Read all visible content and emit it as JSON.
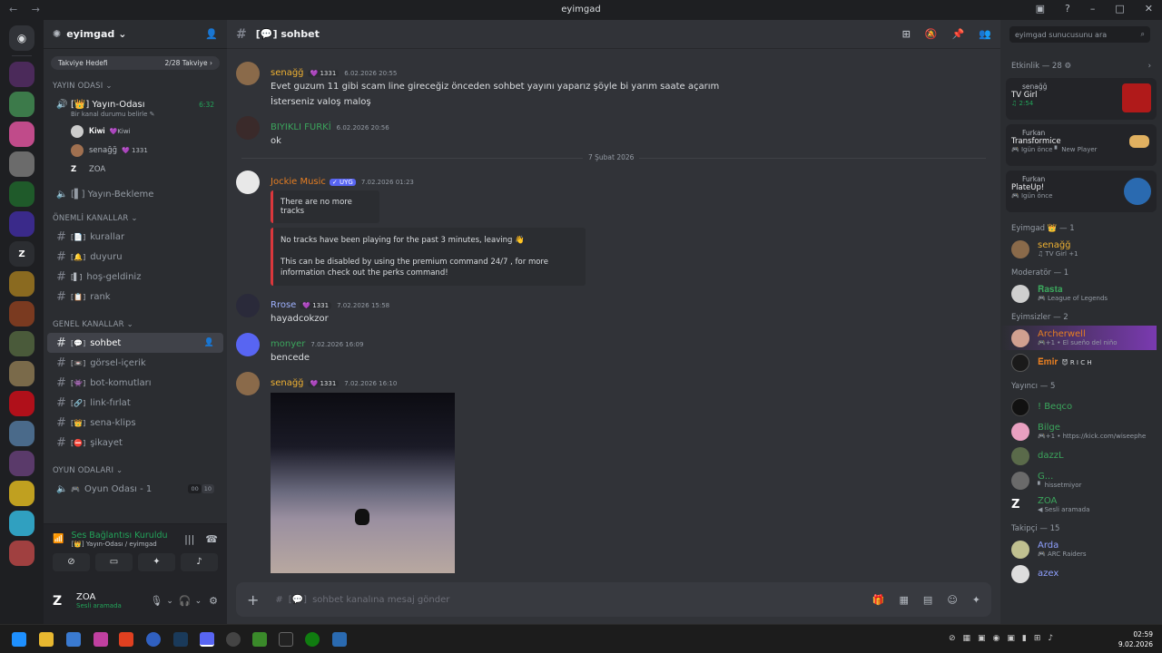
{
  "window": {
    "title": "eyimgad"
  },
  "server": {
    "name": "eyimgad",
    "boost_label": "Takviye Hedefi",
    "boost_count": "2/28 Takviye ›"
  },
  "channels": {
    "cat_voice": "YAYIN ODASI ⌄",
    "voice_room": "[👑] Yayın-Odası",
    "voice_time": "6:32",
    "voice_status": "Bir kanal durumu belirle ✎",
    "voice_users": [
      {
        "name": "𝐊𝐢𝐰𝐢",
        "tag": "💜Kiwi"
      },
      {
        "name": "senağğ",
        "tag": "💜 1331"
      },
      {
        "name": "ZOA",
        "tag": ""
      }
    ],
    "wait_room": "[▌] Yayın-Bekleme",
    "cat_important": "ÖNEMLİ KANALLAR ⌄",
    "important": [
      "kurallar",
      "duyuru",
      "hoş-geldiniz",
      "rank"
    ],
    "cat_general": "GENEL KANALLAR ⌄",
    "general": [
      "sohbet",
      "görsel-içerik",
      "bot-komutları",
      "link-fırlat",
      "sena-klips",
      "şikayet"
    ],
    "cat_game": "OYUN ODALARI ⌄",
    "game_room": "Oyun Odası - 1",
    "game_count_a": "00",
    "game_count_b": "10"
  },
  "voicebar": {
    "status": "Ses Bağlantısı Kuruldu",
    "channel": "[👑] Yayın-Odası / eyimgad"
  },
  "userbar": {
    "name": "ZOA",
    "status": "Sesli aramada"
  },
  "chat": {
    "channel": "[💬] sohbet",
    "messages": [
      {
        "author": "senağğ",
        "tag": "💜 1331",
        "time": "6.02.2026 20:55",
        "lines": [
          "Evet guzum 11 gibi scam line gireceğiz önceden sohbet yayını yaparız şöyle bi yarım saate açarım",
          "İsterseniz valoş maloş"
        ]
      },
      {
        "author": "BIYIKLI FURKİ",
        "time": "6.02.2026 20:56",
        "lines": [
          "ok"
        ]
      },
      {
        "author": "Jockie Music",
        "tag": "✓ UYG",
        "time": "7.02.2026 01:23",
        "embed1": "There are no more tracks",
        "embed2a": "No tracks have been playing for the past 3 minutes, leaving 👋",
        "embed2b": "This can be disabled by using the premium command 24/7 , for more information check out the perks command!"
      },
      {
        "author": "Rrose",
        "tag": "💜 1331",
        "time": "7.02.2026 15:58",
        "lines": [
          "hayadcokzor"
        ]
      },
      {
        "author": "monyer",
        "time": "7.02.2026 16:09",
        "lines": [
          "bencede"
        ]
      },
      {
        "author": "senağğ",
        "tag": "💜 1331",
        "time": "7.02.2026 16:10"
      }
    ],
    "divider": "7 Şubat 2026",
    "composer_placeholder": "sohbet kanalına mesaj gönder"
  },
  "members": {
    "search_placeholder": "eyimgad sunucusunu ara",
    "activity_title": "Etkinlik — 28 ⚙",
    "activities": [
      {
        "user": "senağğ",
        "title": "TV Girl",
        "sub": "♫ 2:54"
      },
      {
        "user": "Furkan",
        "title": "Transformice",
        "sub": "🎮 Igün önce  ▘ New Player"
      },
      {
        "user": "Furkan",
        "title": "PlateUp!",
        "sub": "🎮 Igün önce"
      }
    ],
    "groups": [
      {
        "title": "Eyimgad 👑 — 1",
        "items": [
          {
            "name": "senağğ",
            "sub": "♫ TV Girl +1",
            "color": "#f0b232"
          }
        ]
      },
      {
        "title": "Moderatör — 1",
        "items": [
          {
            "name": "𝐑𝐚𝐬𝐭𝐚",
            "sub": "🎮 League of Legends",
            "color": "#3ba55c"
          }
        ]
      },
      {
        "title": "Eyimsizler — 2",
        "items": [
          {
            "name": "Archerwell",
            "sub": "🎮+1 • El sueño del niño",
            "color": "#e67e22"
          },
          {
            "name": "𝐄𝐦𝐢𝐫",
            "sub": "😈 R I C H",
            "color": "#e67e22"
          }
        ]
      },
      {
        "title": "Yayıncı — 5",
        "items": [
          {
            "name": "! Beqco",
            "sub": "",
            "color": "#3ba55c"
          },
          {
            "name": "Bilge",
            "sub": "🎮+1 • https://kick.com/wiseephe",
            "color": "#3ba55c"
          },
          {
            "name": "dazzL",
            "sub": "",
            "color": "#3ba55c"
          },
          {
            "name": "G...",
            "sub": "▘ hissetmiyor",
            "color": "#3ba55c"
          },
          {
            "name": "ZOA",
            "sub": "◀ Sesli aramada",
            "color": "#3ba55c"
          }
        ]
      },
      {
        "title": "Takipçi — 15",
        "items": [
          {
            "name": "Arda",
            "sub": "🎮 ARC Raiders",
            "color": "#5865f2"
          },
          {
            "name": "azex",
            "sub": "",
            "color": "#5865f2"
          }
        ]
      }
    ]
  },
  "taskbar": {
    "time": "02:59",
    "date": "9.02.2026"
  }
}
